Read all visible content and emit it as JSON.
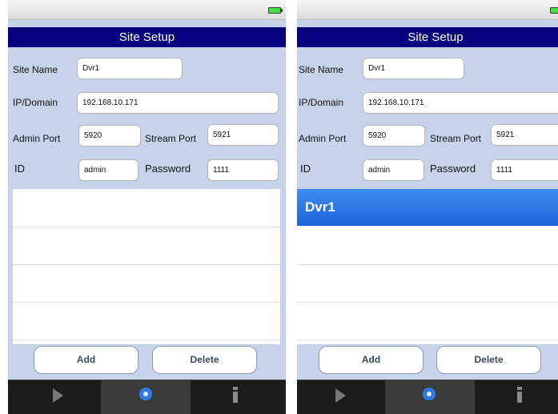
{
  "screens": [
    {
      "title": "Site Setup",
      "fields": {
        "site_name_label": "Site Name",
        "site_name_value": "Dvr1",
        "ip_label": "IP/Domain",
        "ip_value": "192.168.10.171",
        "admin_port_label": "Admin Port",
        "admin_port_value": "5920",
        "stream_port_label": "Stream Port",
        "stream_port_value": "5921",
        "id_label": "ID",
        "id_value": "admin",
        "password_label": "Password",
        "password_value": "1111"
      },
      "list": {
        "items": []
      },
      "buttons": {
        "add": "Add",
        "delete": "Delete"
      },
      "tabs": [
        {
          "icon": "play-icon",
          "active": false
        },
        {
          "icon": "gear-icon",
          "active": true
        },
        {
          "icon": "info-icon",
          "active": false
        }
      ]
    },
    {
      "title": "Site Setup",
      "fields": {
        "site_name_label": "Site Name",
        "site_name_value": "Dvr1",
        "ip_label": "IP/Domain",
        "ip_value": "192.168.10.171",
        "admin_port_label": "Admin Port",
        "admin_port_value": "5920",
        "stream_port_label": "Stream Port",
        "stream_port_value": "5921",
        "id_label": "ID",
        "id_value": "admin",
        "password_label": "Password",
        "password_value": "1111"
      },
      "list": {
        "items": [
          "Dvr1"
        ],
        "selected": "Dvr1"
      },
      "buttons": {
        "add": "Add",
        "delete": "Delete"
      },
      "tabs": [
        {
          "icon": "play-icon",
          "active": false
        },
        {
          "icon": "gear-icon",
          "active": true
        },
        {
          "icon": "info-icon",
          "active": false
        }
      ]
    }
  ],
  "colors": {
    "title_bar": "#07007d",
    "background": "#c7d3ea",
    "selected_row": "#2a74e6",
    "battery": "#47e03c"
  }
}
